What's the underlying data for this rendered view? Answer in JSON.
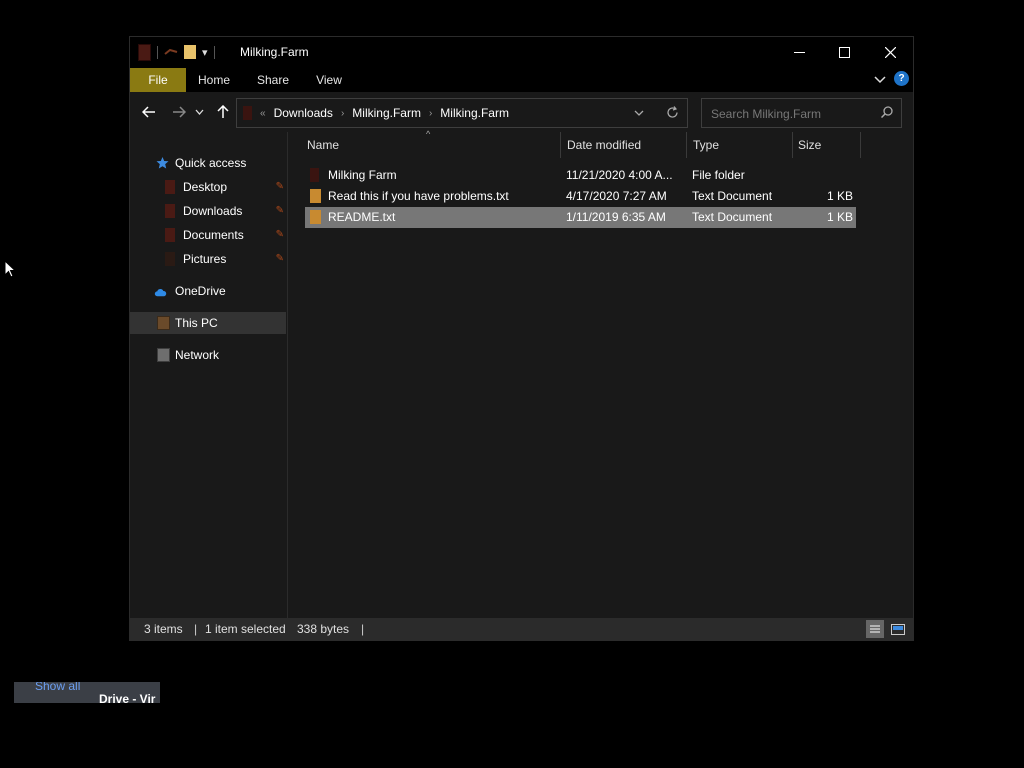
{
  "window": {
    "title": "Milking.Farm",
    "controls": {
      "minimize": "—",
      "maximize": "☐",
      "close": "✕"
    }
  },
  "ribbon": {
    "tabs": [
      {
        "label": "File"
      },
      {
        "label": "Home"
      },
      {
        "label": "Share"
      },
      {
        "label": "View"
      }
    ],
    "help_label": "?"
  },
  "address_bar": {
    "overflow": "«",
    "crumbs": [
      "Downloads",
      "Milking.Farm",
      "Milking.Farm"
    ]
  },
  "search": {
    "placeholder": "Search Milking.Farm"
  },
  "sidebar": {
    "items": [
      {
        "label": "Quick access",
        "icon": "star-icon"
      },
      {
        "label": "Desktop",
        "icon": "folder-icon",
        "pinned": true
      },
      {
        "label": "Downloads",
        "icon": "download-folder-icon",
        "pinned": true
      },
      {
        "label": "Documents",
        "icon": "documents-folder-icon",
        "pinned": true
      },
      {
        "label": "Pictures",
        "icon": "pictures-folder-icon",
        "pinned": true
      },
      {
        "label": "OneDrive",
        "icon": "cloud-icon"
      },
      {
        "label": "This PC",
        "icon": "computer-icon",
        "selected": true
      },
      {
        "label": "Network",
        "icon": "network-icon"
      }
    ]
  },
  "columns": [
    "Name",
    "Date modified",
    "Type",
    "Size"
  ],
  "files": [
    {
      "name": "Milking Farm",
      "date": "11/21/2020 4:00 A...",
      "type": "File folder",
      "size": "",
      "icon": "folder-icon",
      "selected": false
    },
    {
      "name": "Read this if you have problems.txt",
      "date": "4/17/2020 7:27 AM",
      "type": "Text Document",
      "size": "1 KB",
      "icon": "text-file-icon",
      "selected": false
    },
    {
      "name": "README.txt",
      "date": "1/11/2019 6:35 AM",
      "type": "Text Document",
      "size": "1 KB",
      "icon": "text-file-icon",
      "selected": true
    }
  ],
  "status": {
    "items": "3 items",
    "selected": "1 item selected",
    "size": "338 bytes"
  },
  "background_thumb": {
    "text_a": "Show all",
    "text_b": "Drive - Vir"
  },
  "colors": {
    "file_tab": "#8a7a12",
    "selection": "#777777",
    "window_bg": "#191919",
    "accent_blue": "#1e73c8"
  }
}
